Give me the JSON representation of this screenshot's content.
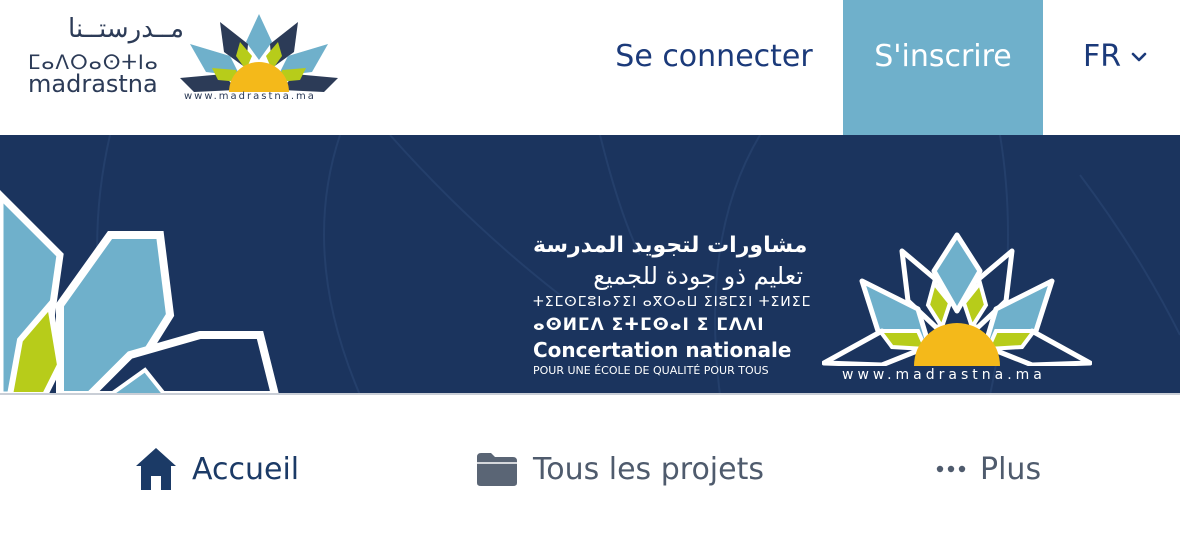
{
  "header": {
    "logo": {
      "arabic": "مــدرستــنا",
      "tifinagh": "ⵎⴰⴷⵔⴰⵙⵜⵏⴰ",
      "latin": "madrastna",
      "url": "www.madrastna.ma"
    },
    "login_label": "Se connecter",
    "signup_label": "S'inscrire",
    "language": "FR"
  },
  "banner": {
    "arabic_title": "مشاورات لتجويد المدرسة",
    "arabic_subtitle": "تعليم ذو جودة للجميع",
    "tifinagh_line1": "ⵜⵉⵎⵙⵎⵓⵏⴰⵢⵉⵏ ⴰⴳⵔⴰⵡ ⵉⵏⵓⵎⵉⵏ ⵜⵉⵍⵉⵎ",
    "tifinagh_line2": "ⴰⵙⵍⵎⴷ ⵉⵜⵎⵙⴰⵏ ⵉ ⵎⴷⴷⵏ",
    "french_title": "Concertation nationale",
    "french_subtitle": "POUR UNE ÉCOLE DE QUALITÉ POUR TOUS",
    "url": "www.madrastna.ma"
  },
  "tabs": [
    {
      "label": "Accueil",
      "icon": "home-icon"
    },
    {
      "label": "Tous les projets",
      "icon": "folder-icon"
    },
    {
      "label": "Plus",
      "icon": "more-icon"
    }
  ],
  "colors": {
    "navy": "#1b345e",
    "accent_blue": "#6fb0cb",
    "sun_yellow": "#f4b91a",
    "leaf_green": "#b7cc1a",
    "petal_blue": "#6fb0cb"
  }
}
